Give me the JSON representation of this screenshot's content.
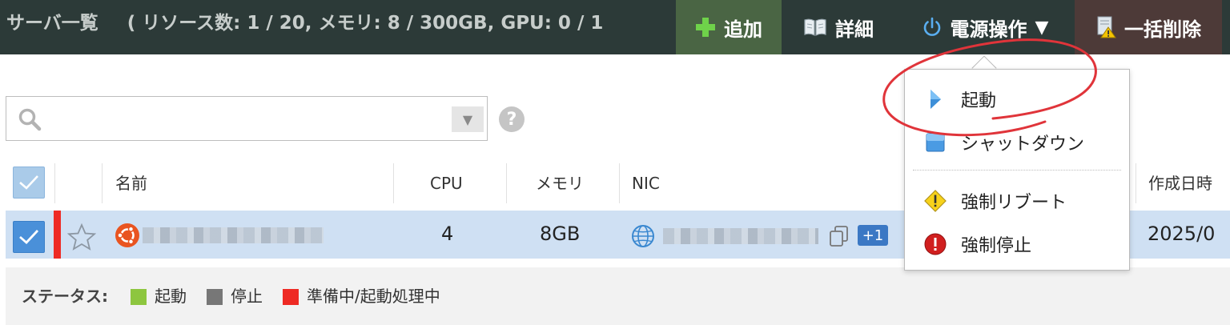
{
  "header": {
    "title": "サーバ一覧",
    "resources": "( リソース数: 1 / 20, メモリ: 8 / 300GB, GPU: 0 / 1",
    "buttons": {
      "add": "追加",
      "detail": "詳細",
      "power": "電源操作",
      "delete": "一括削除"
    }
  },
  "search": {
    "value": "",
    "placeholder": ""
  },
  "table": {
    "columns": {
      "name": "名前",
      "cpu": "CPU",
      "memory": "メモリ",
      "nic": "NIC",
      "created": "作成日時"
    },
    "rows": [
      {
        "cpu": "4",
        "memory": "8GB",
        "nic_extra": "+1",
        "created": "2025/0",
        "status_color": "#ee2a24"
      }
    ]
  },
  "status": {
    "label": "ステータス:",
    "legend": [
      {
        "text": "起動",
        "color": "#8dc63f"
      },
      {
        "text": "停止",
        "color": "#777777"
      },
      {
        "text": "準備中/起動処理中",
        "color": "#ee2a24"
      }
    ]
  },
  "power_menu": {
    "items": [
      {
        "label": "起動",
        "icon": "play-icon"
      },
      {
        "label": "シャットダウン",
        "icon": "stop-icon"
      },
      {
        "label": "強制リブート",
        "icon": "warning-icon"
      },
      {
        "label": "強制停止",
        "icon": "error-icon"
      }
    ]
  },
  "colors": {
    "header_bg": "#2c3a38",
    "add_bg": "#4a6544",
    "delete_bg": "#4d3a38",
    "row_selected": "#cfe0f3",
    "annotation": "#e0343a"
  }
}
